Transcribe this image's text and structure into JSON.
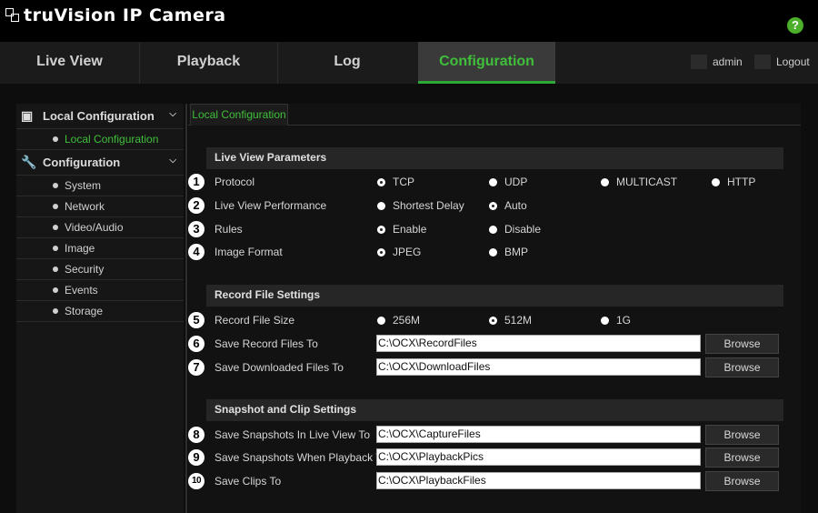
{
  "app": {
    "title": "truVision IP Camera"
  },
  "nav": {
    "tabs": [
      "Live View",
      "Playback",
      "Log",
      "Configuration"
    ],
    "user": "admin",
    "logout": "Logout"
  },
  "sidebar": {
    "groups": [
      {
        "label": "Local Configuration",
        "items": [
          "Local Configuration"
        ]
      },
      {
        "label": "Configuration",
        "items": [
          "System",
          "Network",
          "Video/Audio",
          "Image",
          "Security",
          "Events",
          "Storage"
        ]
      }
    ]
  },
  "panel": {
    "tab": "Local Configuration",
    "sections": [
      "Live View Parameters",
      "Record File Settings",
      "Snapshot and Clip Settings"
    ],
    "protocol": {
      "label": "Protocol",
      "options": [
        "TCP",
        "UDP",
        "MULTICAST",
        "HTTP"
      ],
      "selected": "TCP"
    },
    "performance": {
      "label": "Live View Performance",
      "options": [
        "Shortest Delay",
        "Auto"
      ],
      "selected": "Auto"
    },
    "rules": {
      "label": "Rules",
      "options": [
        "Enable",
        "Disable"
      ],
      "selected": "Enable"
    },
    "image_format": {
      "label": "Image Format",
      "options": [
        "JPEG",
        "BMP"
      ],
      "selected": "JPEG"
    },
    "record_size": {
      "label": "Record File Size",
      "options": [
        "256M",
        "512M",
        "1G"
      ],
      "selected": "512M"
    },
    "paths": [
      {
        "label": "Save Record Files To",
        "value": "C:\\OCX\\RecordFiles"
      },
      {
        "label": "Save Downloaded Files To",
        "value": "C:\\OCX\\DownloadFiles"
      },
      {
        "label": "Save Snapshots In Live View To",
        "value": "C:\\OCX\\CaptureFiles"
      },
      {
        "label": "Save Snapshots When Playback To",
        "value": "C:\\OCX\\PlaybackPics"
      },
      {
        "label": "Save Clips To",
        "value": "C:\\OCX\\PlaybackFiles"
      }
    ],
    "browse_label": "Browse",
    "callouts": [
      "1",
      "2",
      "3",
      "4",
      "5",
      "6",
      "7",
      "8",
      "9",
      "10"
    ]
  },
  "colors": {
    "accent": "#3fbf3a",
    "help": "#4caf2a"
  },
  "icons": [
    "logo-icon",
    "help-icon",
    "user-icon",
    "logout-icon",
    "monitor-icon",
    "wrench-icon",
    "chevron-down-icon"
  ]
}
